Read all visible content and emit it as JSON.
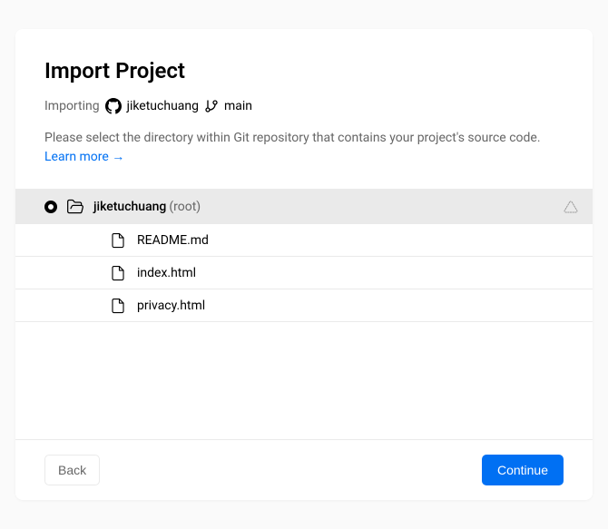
{
  "title": "Import Project",
  "importing_label": "Importing",
  "repo_name": "jiketuchuang",
  "branch_name": "main",
  "description_prefix": "Please select the directory within Git repository that contains your project's source code. ",
  "learn_more_label": "Learn more →",
  "tree": {
    "root_name": "jiketuchuang",
    "root_suffix": "(root)",
    "files": [
      "README.md",
      "index.html",
      "privacy.html"
    ]
  },
  "footer": {
    "back_label": "Back",
    "continue_label": "Continue"
  }
}
